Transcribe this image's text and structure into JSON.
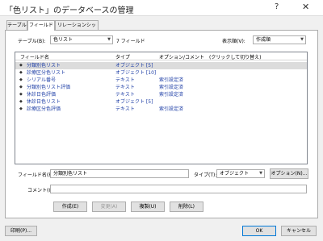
{
  "window": {
    "title": "「色リスト」のデータベースの管理",
    "help": "?",
    "close": "✕"
  },
  "tabs": [
    "テーブル",
    "フィールド",
    "リレーションシップ"
  ],
  "table_select": {
    "label": "テーブル(B):",
    "value": "色リスト",
    "count": "7 フィールド"
  },
  "view_order": {
    "label": "表示順(V):",
    "value": "作成順"
  },
  "grid": {
    "headers": {
      "name": "フィールド名",
      "type": "タイプ",
      "options": "オプション/コメント　(クリックして切り替え)"
    },
    "rows": [
      {
        "name": "分類別色リスト",
        "type": "オブジェクト [5]",
        "options": ""
      },
      {
        "name": "診療区分色リスト",
        "type": "オブジェクト [10]",
        "options": ""
      },
      {
        "name": "シリアル番号",
        "type": "テキスト",
        "options": "索引設定済"
      },
      {
        "name": "分類別色リスト評価",
        "type": "テキスト",
        "options": "索引設定済"
      },
      {
        "name": "休診日色評価",
        "type": "テキスト",
        "options": "索引設定済"
      },
      {
        "name": "休診日色リスト",
        "type": "オブジェクト [5]",
        "options": ""
      },
      {
        "name": "診療区分色評価",
        "type": "テキスト",
        "options": "索引設定済"
      }
    ]
  },
  "field_name": {
    "label": "フィールド名(F):",
    "value": "分類別色リスト"
  },
  "field_type": {
    "label": "タイプ(T):",
    "value": "オブジェクト"
  },
  "options_button": "オプション(N)...",
  "comment": {
    "label": "コメント(O):",
    "value": ""
  },
  "actions": {
    "create": "作成(E)",
    "change": "変更(A)",
    "duplicate": "複製(U)",
    "delete": "削除(L)"
  },
  "footer": {
    "print": "印刷(P)...",
    "ok": "OK",
    "cancel": "キャンセル"
  }
}
